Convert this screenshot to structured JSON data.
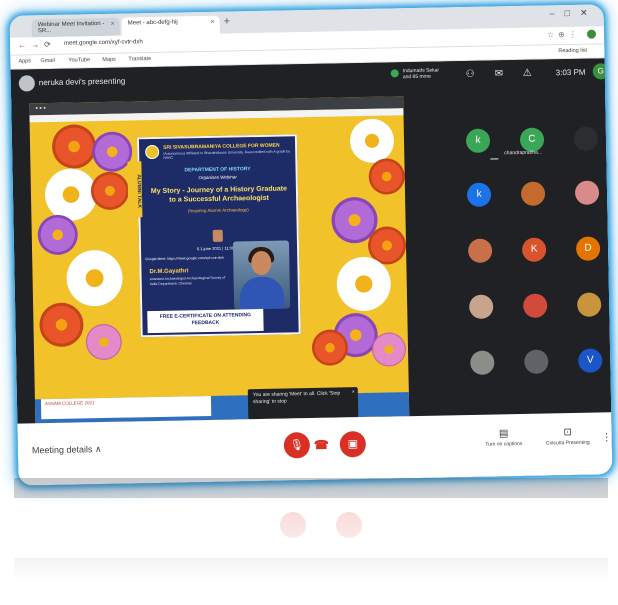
{
  "browser": {
    "tabs": [
      {
        "label": "Webinar Meet Invitation - SR..."
      },
      {
        "label": "Meet - abc-defg-hij"
      }
    ],
    "new_tab": "+",
    "url": "meet.google.com/xyf-cvtr-dxh",
    "bookmarks": [
      "Apps",
      "Gmail",
      "YouTube",
      "Maps",
      "Translate"
    ],
    "reading_list": "Reading list"
  },
  "meet": {
    "presenting_label": "neruka devi's presenting",
    "pinned_name": "Indumathi Sekar and 85 more",
    "time": "3:03 PM",
    "self_initial": "G",
    "active_tile_name": "chandraprabha...",
    "meeting_details": "Meeting details",
    "captions_label": "Turn on captions",
    "present_label": "Colcutta Presenting",
    "participants": [
      {
        "initial": "k",
        "color": "#3aa757"
      },
      {
        "initial": "C",
        "color": "#3aa757"
      },
      {
        "initial": "",
        "color": "#2b2d30"
      },
      {
        "initial": "k",
        "color": "#1a73e8"
      },
      {
        "initial": "",
        "color": "#c56a2f"
      },
      {
        "initial": "",
        "color": "#d98b8b"
      },
      {
        "initial": "",
        "color": "#c7704a"
      },
      {
        "initial": "K",
        "color": "#d9542c"
      },
      {
        "initial": "D",
        "color": "#e37400"
      },
      {
        "initial": "",
        "color": "#c7a48c"
      },
      {
        "initial": "",
        "color": "#d24a3a"
      },
      {
        "initial": "",
        "color": "#c8953e"
      },
      {
        "initial": "",
        "color": "#8a8f8a"
      },
      {
        "initial": "",
        "color": "#5f6368"
      },
      {
        "initial": "V",
        "color": "#1a56c8"
      }
    ]
  },
  "poster": {
    "college": "SRI SIVASUBRAMANIYA COLLEGE FOR WOMEN",
    "college_sub": "(Autonomous) Affiliated to Bharathidasan University, Reaccredited with A grade by NAAC",
    "department": "DEPARTMENT OF HISTORY",
    "event_type": "Organises Webinar",
    "title": "My Story - Journey of a History Graduate to a Successful Archaeologist",
    "topic": "(Inspiring Alumni Archaeology)",
    "date": "6.1.june 2021 | 11:00 PM",
    "link": "Google Meet: https://meet.google.com/xyf-cvtr-dxh",
    "speaker": "Dr.M.Gayathri",
    "speaker_desc": "Assistant Archaeologist Archaeological Survey of India Department, Chennai",
    "badge": "ALUMNI TALK",
    "banner": "FREE E-CERTIFICATE ON ATTENDING FEEDBACK"
  },
  "share": {
    "doc_text": "ASSAM COLLEGE 2021",
    "notice": "You are sharing 'Meet' to all. Click 'Stop sharing' to stop",
    "notice_close": "×"
  },
  "colors": {
    "meet_bg": "#202124",
    "accent_red": "#d93025",
    "card_glow": "#2e9fe0",
    "poster_bg": "#1d2b66",
    "share_bg": "#f2c22a"
  }
}
